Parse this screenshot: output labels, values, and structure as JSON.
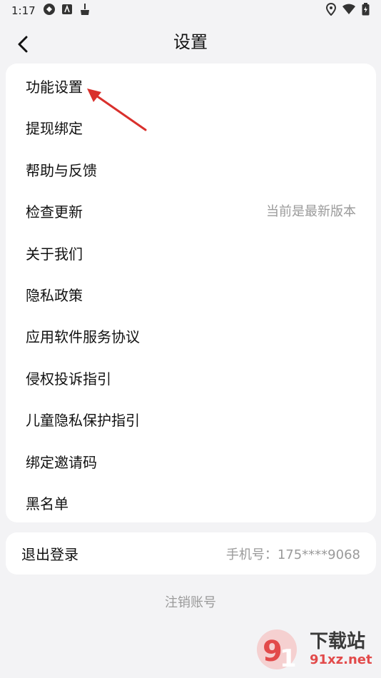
{
  "status": {
    "time": "1:17"
  },
  "header": {
    "title": "设置"
  },
  "menu": {
    "items": [
      {
        "label": "功能设置",
        "right": ""
      },
      {
        "label": "提现绑定",
        "right": ""
      },
      {
        "label": "帮助与反馈",
        "right": ""
      },
      {
        "label": "检查更新",
        "right": "当前是最新版本"
      },
      {
        "label": "关于我们",
        "right": ""
      },
      {
        "label": "隐私政策",
        "right": ""
      },
      {
        "label": "应用软件服务协议",
        "right": ""
      },
      {
        "label": "侵权投诉指引",
        "right": ""
      },
      {
        "label": "儿童隐私保护指引",
        "right": ""
      },
      {
        "label": "绑定邀请码",
        "right": ""
      },
      {
        "label": "黑名单",
        "right": ""
      }
    ]
  },
  "account": {
    "logout_label": "退出登录",
    "phone": "手机号：175****9068",
    "cancel_label": "注销账号"
  },
  "watermark": {
    "line1": "下载站",
    "line2": "91xz.net"
  },
  "colors": {
    "background": "#f3f3f5",
    "card": "#ffffff",
    "annotation_arrow": "#d9302c"
  }
}
